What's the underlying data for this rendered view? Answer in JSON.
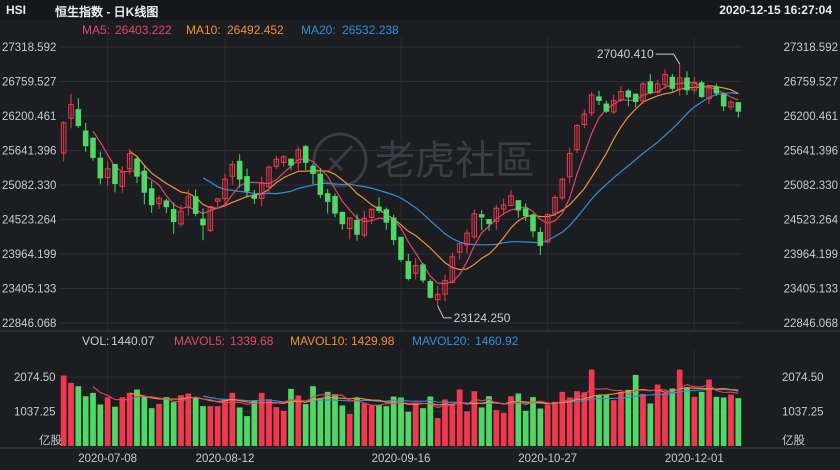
{
  "header": {
    "symbol": "HSI",
    "title": "恒生指数 - 日K线图",
    "datetime": "2020-12-15 16:27:04"
  },
  "watermark": "老虎社區",
  "colors": {
    "background": "#1c1d21",
    "up": "#f0384e",
    "down": "#4fd865",
    "ma5": "#e0456b",
    "ma10": "#f2922c",
    "ma20": "#2e8fe0",
    "grid": "#2c2d32"
  },
  "price_legend": {
    "ma5_label": "MA5:",
    "ma5_value": "26403.222",
    "ma10_label": "MA10:",
    "ma10_value": "26492.452",
    "ma20_label": "MA20:",
    "ma20_value": "26532.238"
  },
  "volume_legend": {
    "vol_label": "VOL:",
    "vol_value": "1440.07",
    "mavol5_label": "MAVOL5:",
    "mavol5_value": "1339.68",
    "mavol10_label": "MAVOL10:",
    "mavol10_value": "1429.98",
    "mavol20_label": "MAVOL20:",
    "mavol20_value": "1460.92"
  },
  "annotations": {
    "high_label": "27040.410",
    "low_label": "23124.250"
  },
  "chart_data": {
    "type": "candlestick",
    "price_axis": {
      "ticks": [
        27318.592,
        26759.527,
        26200.461,
        25641.396,
        25082.33,
        24523.264,
        23964.199,
        23405.133,
        22846.068
      ],
      "tick_labels": [
        "27318.592",
        "26759.527",
        "26200.461",
        "25641.396",
        "25082.330",
        "24523.264",
        "23964.199",
        "23405.133",
        "22846.068"
      ],
      "range": [
        22846.068,
        27318.592
      ]
    },
    "volume_axis": {
      "ticks": [
        2074.5,
        1037.25
      ],
      "tick_labels": [
        "2074.50",
        "1037.25"
      ],
      "range": [
        0,
        2800
      ],
      "unit_label": "亿股"
    },
    "x_labels": [
      {
        "index": 6,
        "label": "2020-07-08"
      },
      {
        "index": 22,
        "label": "2020-08-12"
      },
      {
        "index": 46,
        "label": "2020-09-16"
      },
      {
        "index": 66,
        "label": "2020-10-27"
      },
      {
        "index": 86,
        "label": "2020-12-01"
      }
    ],
    "high_index": 84,
    "low_index": 51,
    "ohlc": [
      [
        25600.33,
        26090.38,
        25466.1,
        26114.33
      ],
      [
        26164.79,
        26385.93,
        26000.21,
        26561.8
      ],
      [
        26304.02,
        26046.08,
        26011.43,
        26486.52
      ],
      [
        25956.85,
        25719.16,
        25622.72,
        26086.46
      ],
      [
        25839.37,
        25530.44,
        25476.47,
        25854.87
      ],
      [
        25516.93,
        25198.09,
        25093.26,
        25623.6
      ],
      [
        25204.12,
        25344.98,
        25071.87,
        25465.53
      ],
      [
        25415.05,
        25106.36,
        24962.2,
        25421.16
      ],
      [
        25060.41,
        25291.54,
        24957.68,
        25384.71
      ],
      [
        25345.53,
        25591.75,
        25249.64,
        25668.98
      ],
      [
        25502.94,
        25225.66,
        25112.95,
        25557.57
      ],
      [
        25307.39,
        24966.04,
        24767.62,
        25389.6
      ],
      [
        25020.67,
        24763.43,
        24630.81,
        25149.63
      ],
      [
        24779.22,
        24868.56,
        24693.84,
        24914.35
      ],
      [
        24823.61,
        24731.49,
        24623.25,
        24855.78
      ],
      [
        24685.75,
        24488.99,
        24287.63,
        24797.03
      ],
      [
        24451.78,
        24658.38,
        24404.96,
        24763.97
      ],
      [
        24725.63,
        24891.56,
        24591.8,
        25006.88
      ],
      [
        24890.25,
        24622.4,
        24574.68,
        25008.7
      ],
      [
        24529.33,
        24435.12,
        24186.68,
        24701.83
      ],
      [
        24347.8,
        24734.66,
        24315.51,
        24745.25
      ],
      [
        24819.12,
        24859.53,
        24717.74,
        24873.04
      ],
      [
        24860.49,
        25176.64,
        24723.83,
        25267.08
      ],
      [
        25224.18,
        25414.47,
        25085.39,
        25473.93
      ],
      [
        25465.83,
        25180.02,
        25043.65,
        25582.38
      ],
      [
        25218.99,
        24986.45,
        24878.84,
        25349.48
      ],
      [
        24917.63,
        24865.28,
        24771.54,
        25003.49
      ],
      [
        24864.55,
        25122.36,
        24739.59,
        25215.46
      ],
      [
        25055.63,
        25372.99,
        24940.57,
        25396.63
      ],
      [
        25385.76,
        25497.96,
        25341.53,
        25553.7
      ],
      [
        25448.26,
        25539.54,
        25376.67,
        25564.56
      ],
      [
        25501.26,
        25405.33,
        25318.82,
        25505.16
      ],
      [
        25442.57,
        25652.1,
        25307.43,
        25707.75
      ],
      [
        25704.23,
        25450.58,
        25327.42,
        25732.04
      ],
      [
        25385.15,
        25270.79,
        25097.08,
        25431.13
      ],
      [
        25257.66,
        24930.91,
        24867.88,
        25357.36
      ],
      [
        24941.07,
        24817.88,
        24619.03,
        25018.44
      ],
      [
        24895.96,
        24625.91,
        24558.06,
        24943.75
      ],
      [
        24636.98,
        24455.54,
        24356.27,
        24656.08
      ],
      [
        24377.48,
        24549.17,
        24199.19,
        24550.48
      ],
      [
        24507.79,
        24283.89,
        24181.13,
        24607.39
      ],
      [
        24269.61,
        24542.4,
        24229.6,
        24661.77
      ],
      [
        24555.88,
        24690.6,
        24448.82,
        24690.6
      ],
      [
        24724.05,
        24671.11,
        24626.12,
        24880.91
      ],
      [
        24681.09,
        24480.01,
        24357.96,
        24714.91
      ],
      [
        24545.31,
        24197.59,
        24111.51,
        24601.43
      ],
      [
        24234.3,
        23876.29,
        23833.04,
        24240.05
      ],
      [
        23841.42,
        23567.24,
        23535.73,
        23966.96
      ],
      [
        23651.76,
        23776.63,
        23552.1,
        23901.52
      ],
      [
        23788.85,
        23542.55,
        23497.25,
        23816.79
      ],
      [
        23518.28,
        23262.66,
        23242.22,
        23551.55
      ],
      [
        23222.67,
        23310.05,
        23124.25,
        23446.34
      ],
      [
        23312.14,
        23532.04,
        23199.46,
        23627.82
      ],
      [
        23507.06,
        23917.98,
        23485.49,
        23989.78
      ],
      [
        23995.23,
        24130.61,
        23876.47,
        24142.88
      ],
      [
        24112.19,
        24302.57,
        23974.85,
        24361.56
      ],
      [
        24243.67,
        24616.71,
        24209.11,
        24686.38
      ],
      [
        24601.55,
        24565.49,
        24348.61,
        24673.96
      ],
      [
        24523.1,
        24459.24,
        24340.99,
        24526.98
      ],
      [
        24488.44,
        24705.32,
        24358.79,
        24759.53
      ],
      [
        24691.94,
        24758.39,
        24596.6,
        24864.22
      ],
      [
        24750.01,
        24907.02,
        24741.21,
        24997.21
      ],
      [
        24827.75,
        24676.6,
        24556.03,
        24835.14
      ],
      [
        24696.54,
        24587.28,
        24499.54,
        24786.29
      ],
      [
        24596.03,
        24339.66,
        24233.41,
        24627.04
      ],
      [
        24312.46,
        24103.79,
        23950.05,
        24397.67
      ],
      [
        24158.11,
        24607.52,
        24139.98,
        24608.66
      ],
      [
        24625.62,
        24880.82,
        24574.86,
        24919.15
      ],
      [
        24873.44,
        25176.31,
        24831.96,
        25201.71
      ],
      [
        25215.5,
        25593.82,
        25111.7,
        25682.8
      ],
      [
        25656.43,
        26045.64,
        25603.38,
        26072.41
      ],
      [
        26062.13,
        26233.5,
        26004.09,
        26309.1
      ],
      [
        26250.06,
        26540.37,
        26195.93,
        26591.75
      ],
      [
        26509.25,
        26453.35,
        26379.51,
        26608.98
      ],
      [
        26393.68,
        26278.12,
        26249.62,
        26447.77
      ],
      [
        26266.29,
        26448.53,
        26233.16,
        26544.57
      ],
      [
        26464.5,
        26596.24,
        26431.96,
        26683.77
      ],
      [
        26604.38,
        26509.51,
        26356.57,
        26641.63
      ],
      [
        26553.3,
        26435.91,
        26340.75,
        26567.95
      ],
      [
        26446.19,
        26719.39,
        26398.1,
        26760.14
      ],
      [
        26754.45,
        26580.92,
        26553.76,
        26876.4
      ],
      [
        26585.47,
        26720.33,
        26554.87,
        26786.3
      ],
      [
        26706.24,
        26873.38,
        26643.77,
        26956.76
      ],
      [
        26828.31,
        26649.79,
        26600.45,
        26882.48
      ],
      [
        26635.38,
        26818.02,
        26529.83,
        27040.41
      ],
      [
        26816.43,
        26624.01,
        26540.55,
        26924.61
      ],
      [
        26621.59,
        26747.61,
        26568.21,
        26833.15
      ],
      [
        26737.82,
        26517.11,
        26491.03,
        26776.23
      ],
      [
        26483.34,
        26656.16,
        26394.96,
        26698.44
      ],
      [
        26665.86,
        26574.56,
        26522.62,
        26725.3
      ],
      [
        26545.83,
        26364.04,
        26281.87,
        26573.33
      ],
      [
        26346.27,
        26425.57,
        26297.69,
        26461.17
      ],
      [
        26416.61,
        26278.45,
        26175.06,
        26426.15
      ]
    ],
    "volume": [
      2120,
      1900,
      1800,
      1500,
      1600,
      1250,
      1470,
      1180,
      1470,
      1600,
      1700,
      1500,
      1140,
      1270,
      1470,
      1320,
      1530,
      1580,
      1460,
      1200,
      1200,
      1200,
      1410,
      1600,
      1160,
      900,
      1360,
      1600,
      1410,
      1170,
      1060,
      1720,
      1520,
      1260,
      1800,
      1430,
      1630,
      1560,
      1220,
      970,
      1440,
      1280,
      1220,
      1230,
      1200,
      1490,
      1460,
      1030,
      1280,
      1140,
      1490,
      840,
      1400,
      1260,
      1700,
      1040,
      1650,
      1160,
      1500,
      1080,
      1000,
      1500,
      1580,
      1060,
      1470,
      1130,
      1250,
      1330,
      1630,
      1460,
      1650,
      1620,
      2300,
      1520,
      1540,
      1380,
      1630,
      1690,
      2140,
      1570,
      1280,
      1850,
      1600,
      1730,
      2300,
      1770,
      1480,
      1630,
      2000,
      1480,
      1460,
      1550,
      1440
    ]
  }
}
